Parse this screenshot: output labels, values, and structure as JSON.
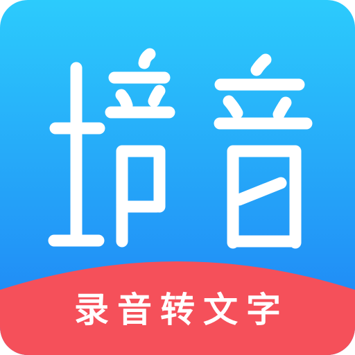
{
  "app_icon": {
    "title": "培音",
    "subtitle": "录音转文字",
    "colors": {
      "gradient_top": "#2ccbfc",
      "gradient_bottom": "#1e80f5",
      "banner": "#f5505a",
      "glyph": "#ffffff"
    }
  }
}
